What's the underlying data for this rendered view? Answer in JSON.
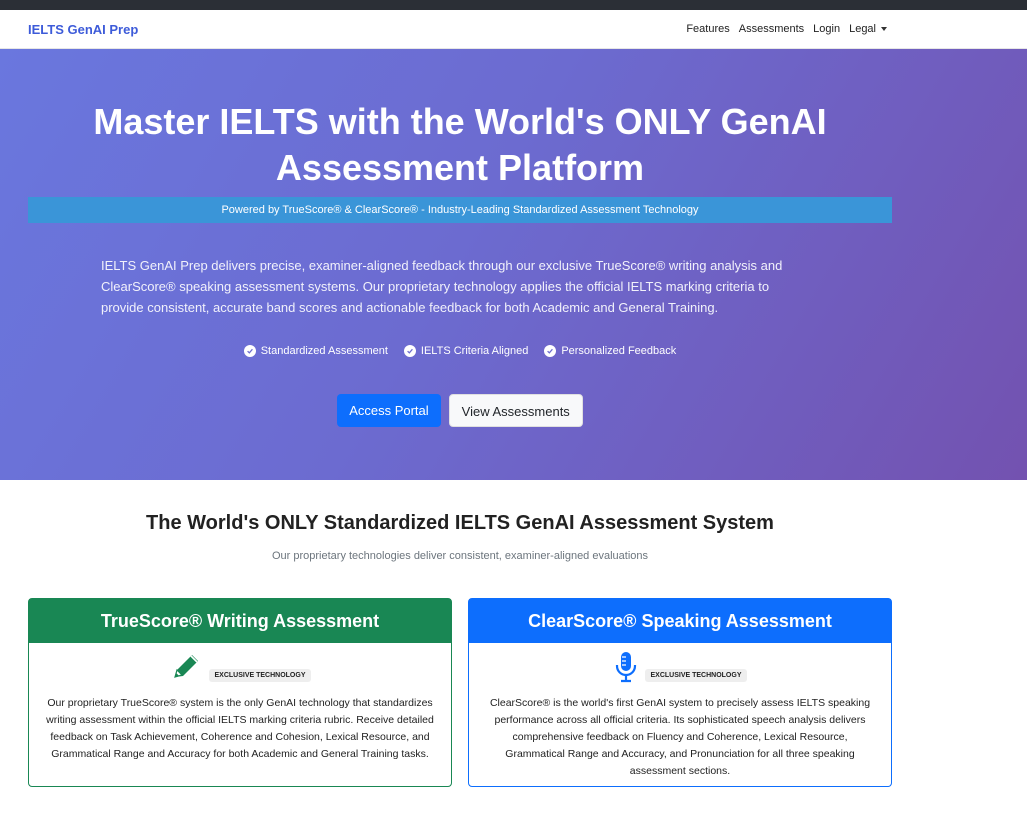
{
  "nav": {
    "brand": "IELTS GenAI Prep",
    "links": [
      "Features",
      "Assessments",
      "Login"
    ],
    "legal": "Legal"
  },
  "hero": {
    "title_line1": "Master IELTS with the World's ONLY GenAI",
    "title_line2": "Assessment Platform",
    "powered": "Powered by TrueScore® & ClearScore® - Industry-Leading Standardized Assessment Technology",
    "description": "IELTS GenAI Prep delivers precise, examiner-aligned feedback through our exclusive TrueScore® writing analysis and ClearScore® speaking assessment systems. Our proprietary technology applies the official IELTS marking criteria to provide consistent, accurate band scores and actionable feedback for both Academic and General Training.",
    "features": [
      "Standardized Assessment",
      "IELTS Criteria Aligned",
      "Personalized Feedback"
    ],
    "primary_button": "Access Portal",
    "secondary_button": "View Assessments"
  },
  "section": {
    "title": "The World's ONLY Standardized IELTS GenAI Assessment System",
    "subtitle": "Our proprietary technologies deliver consistent, examiner-aligned evaluations"
  },
  "cards": {
    "writing": {
      "title": "TrueScore® Writing Assessment",
      "icon": "pencil-icon",
      "badge": "EXCLUSIVE TECHNOLOGY",
      "text": "Our proprietary TrueScore® system is the only GenAI technology that standardizes writing assessment within the official IELTS marking criteria rubric. Receive detailed feedback on Task Achievement, Coherence and Cohesion, Lexical Resource, and Grammatical Range and Accuracy for both Academic and General Training tasks.",
      "color": "#198754"
    },
    "speaking": {
      "title": "ClearScore® Speaking Assessment",
      "icon": "microphone-icon",
      "badge": "EXCLUSIVE TECHNOLOGY",
      "text": "ClearScore® is the world's first GenAI system to precisely assess IELTS speaking performance across all official criteria. Its sophisticated speech analysis delivers comprehensive feedback on Fluency and Coherence, Lexical Resource, Grammatical Range and Accuracy, and Pronunciation for all three speaking assessment sections.",
      "color": "#0d6efd"
    }
  }
}
